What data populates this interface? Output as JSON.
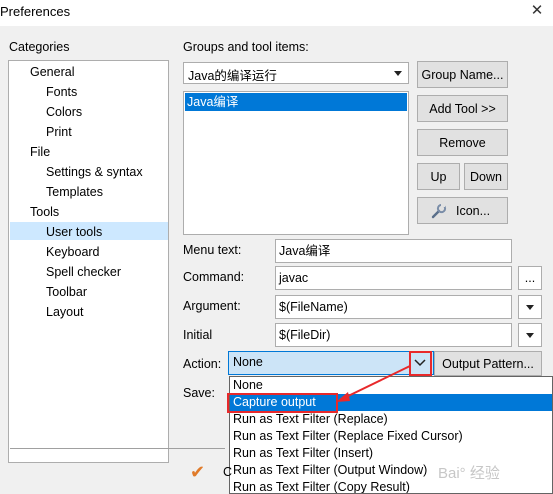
{
  "window": {
    "title": "Preferences",
    "close_glyph": "✕"
  },
  "categories": {
    "label": "Categories",
    "items": [
      {
        "label": "General",
        "level": 1
      },
      {
        "label": "Fonts",
        "level": 2
      },
      {
        "label": "Colors",
        "level": 2
      },
      {
        "label": "Print",
        "level": 2
      },
      {
        "label": "File",
        "level": 1
      },
      {
        "label": "Settings & syntax",
        "level": 2
      },
      {
        "label": "Templates",
        "level": 2
      },
      {
        "label": "Tools",
        "level": 1
      },
      {
        "label": "User tools",
        "level": 2,
        "selected": true
      },
      {
        "label": "Keyboard",
        "level": 2
      },
      {
        "label": "Spell checker",
        "level": 2
      },
      {
        "label": "Toolbar",
        "level": 2
      },
      {
        "label": "Layout",
        "level": 2
      }
    ]
  },
  "groups": {
    "label": "Groups and tool items:",
    "group_combo_value": "Java的编译运行",
    "tool_items": [
      "Java编译"
    ]
  },
  "buttons": {
    "group_name": "Group Name...",
    "add_tool": "Add Tool >>",
    "remove": "Remove",
    "up": "Up",
    "down": "Down",
    "icon": "Icon...",
    "output_pattern": "Output Pattern..."
  },
  "fields": {
    "menu_text": {
      "label": "Menu text:",
      "value": "Java编译"
    },
    "command": {
      "label": "Command:",
      "value": "javac",
      "browse": "..."
    },
    "argument": {
      "label": "Argument:",
      "value": "$(FileName)"
    },
    "initial": {
      "label": "Initial",
      "value": "$(FileDir)"
    }
  },
  "action": {
    "label": "Action:",
    "value": "None",
    "options": [
      "None",
      "Capture output",
      "Run as Text Filter (Replace)",
      "Run as Text Filter (Replace Fixed Cursor)",
      "Run as Text Filter (Insert)",
      "Run as Text Filter (Output Window)",
      "Run as Text Filter (Copy Result)"
    ],
    "highlighted_index": 1
  },
  "save": {
    "label": "Save:"
  },
  "footer": {
    "partial_label": "C",
    "checkmark_glyph": "✔"
  },
  "watermark": "Bai° 经验",
  "colors": {
    "accent": "#0078d7",
    "annotation_red": "#e8292b"
  }
}
